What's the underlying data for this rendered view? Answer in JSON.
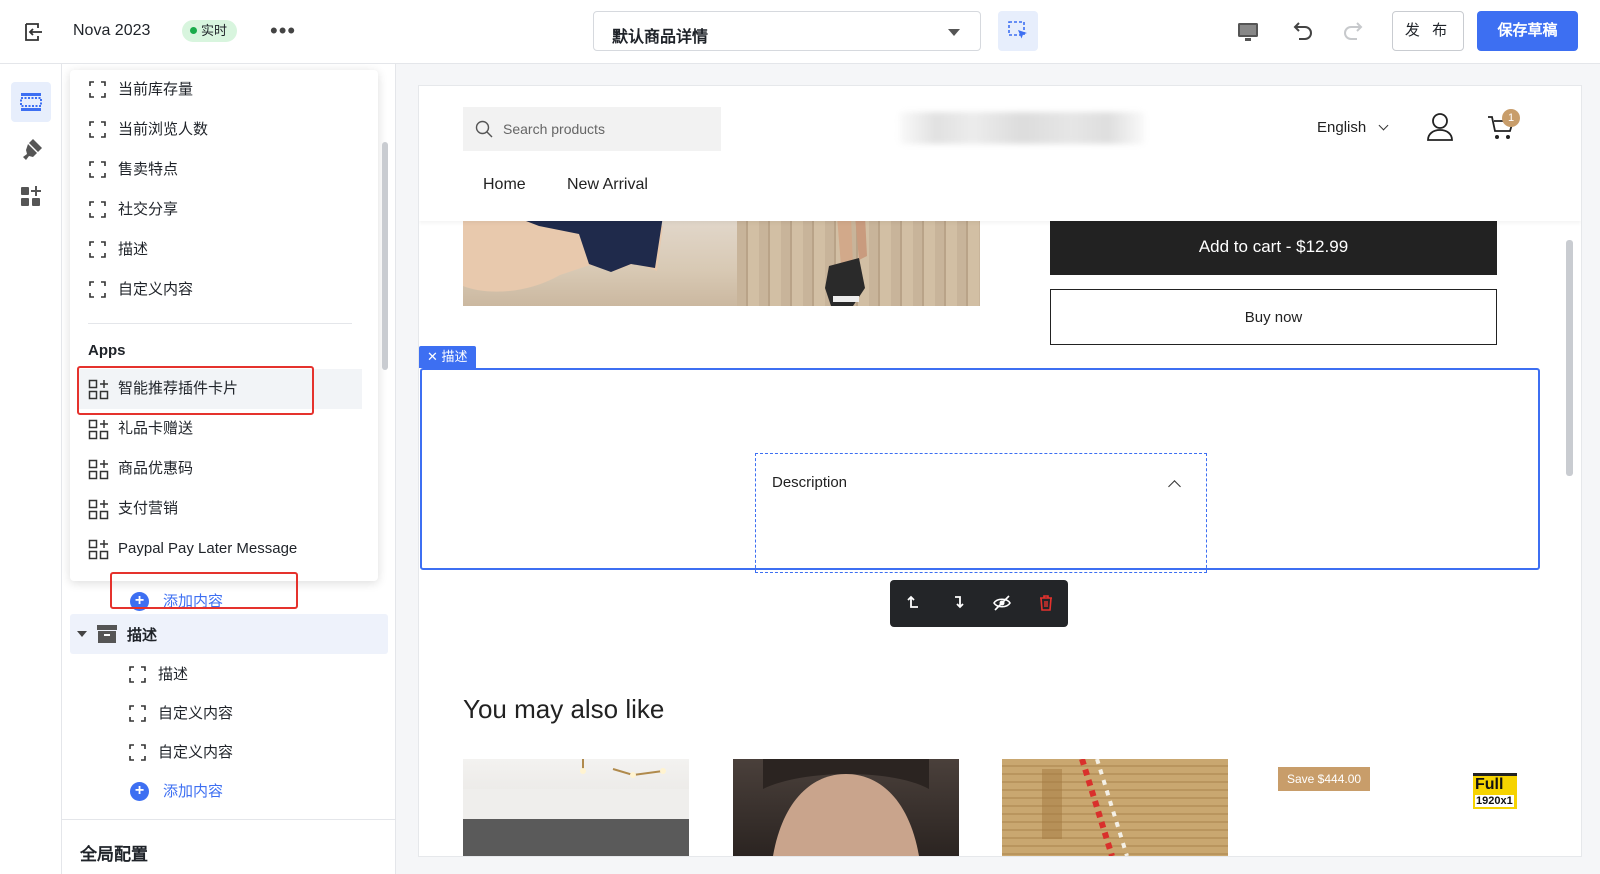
{
  "topbar": {
    "app_name": "Nova 2023",
    "live_badge": "实时",
    "more": "•••",
    "page_select": "默认商品详情",
    "publish_label": "发 布",
    "save_label": "保存草稿"
  },
  "popover": {
    "items": [
      "当前库存量",
      "当前浏览人数",
      "售卖特点",
      "社交分享",
      "描述",
      "自定义内容"
    ],
    "apps_title": "Apps",
    "apps": [
      "智能推荐插件卡片",
      "礼品卡赠送",
      "商品优惠码",
      "支付营销",
      "Paypal Pay Later Message"
    ]
  },
  "sidebar": {
    "add_content": "添加内容",
    "group_label": "描述",
    "group_items": [
      "描述",
      "自定义内容",
      "自定义内容"
    ],
    "add_content_2": "添加内容",
    "global_config": "全局配置"
  },
  "store": {
    "search_placeholder": "Search products",
    "language": "English",
    "cart_count": "1",
    "nav": [
      "Home",
      "New Arrival"
    ],
    "add_to_cart": "Add to cart  -  $12.99",
    "buy_now": "Buy now",
    "selected_tag": "描述",
    "description_label": "Description",
    "also_like": "You may also like",
    "save_badge": "Save $444.00",
    "full_badge_a": "Full",
    "full_badge_b": "1920x1"
  },
  "colors": {
    "accent": "#3d6ff2",
    "danger": "#e5322d",
    "live": "#1aab4b"
  },
  "icons": {
    "back": "exit-icon",
    "select": "select-area-icon",
    "desktop": "desktop-icon",
    "undo": "undo-icon",
    "redo": "redo-icon",
    "sections": "sections-icon",
    "theme": "brush-icon",
    "apps": "apps-icon"
  }
}
